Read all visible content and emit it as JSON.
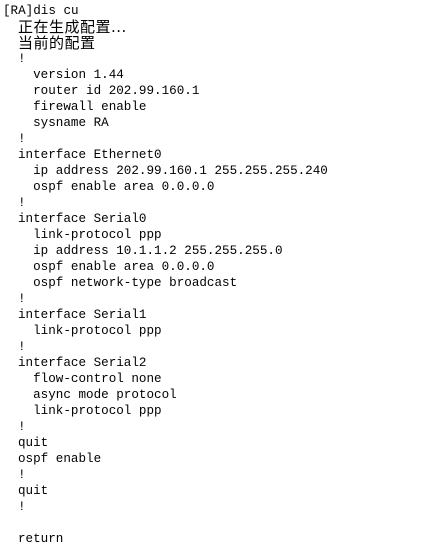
{
  "terminal": {
    "prompt_line": "[RA]dis cu",
    "generating": "正在生成配置...",
    "current_config": "当前的配置",
    "lines": [
      "!",
      "  version 1.44",
      "  router id 202.99.160.1",
      "  firewall enable",
      "  sysname RA",
      "!",
      "interface Ethernet0",
      "  ip address 202.99.160.1 255.255.255.240",
      "  ospf enable area 0.0.0.0",
      "!",
      "interface Serial0",
      "  link-protocol ppp",
      "  ip address 10.1.1.2 255.255.255.0",
      "  ospf enable area 0.0.0.0",
      "  ospf network-type broadcast",
      "!",
      "interface Serial1",
      "  link-protocol ppp",
      "!",
      "interface Serial2",
      "  flow-control none",
      "  async mode protocol",
      "  link-protocol ppp",
      "!",
      "quit",
      "ospf enable",
      "!",
      "quit",
      "!",
      "",
      "return"
    ]
  }
}
